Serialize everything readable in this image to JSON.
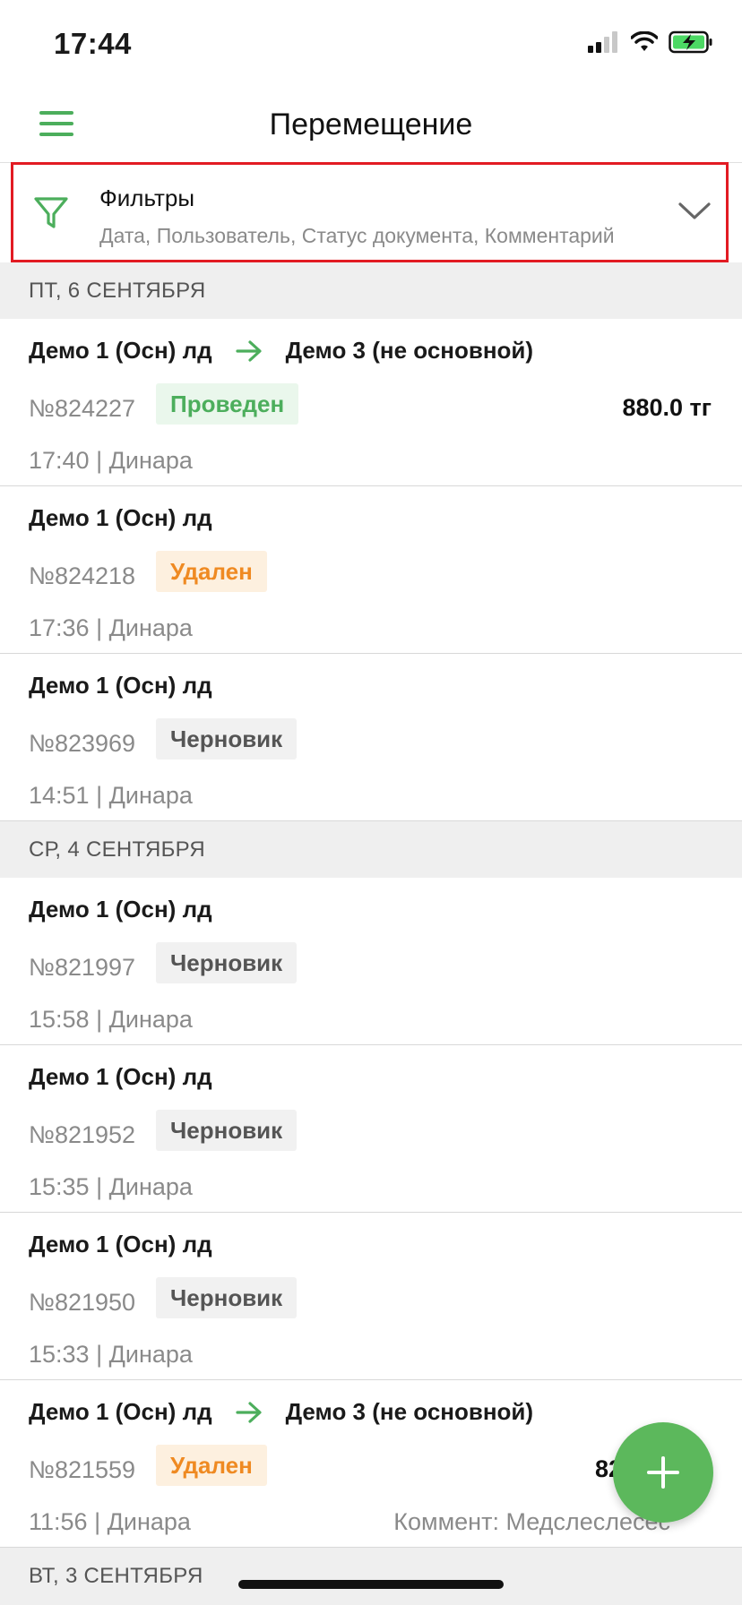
{
  "status_bar": {
    "time": "17:44"
  },
  "nav": {
    "title": "Перемещение"
  },
  "filters": {
    "title": "Фильтры",
    "subtitle": "Дата, Пользователь, Статус документа, Комментарий"
  },
  "sections": [
    {
      "date": "ПТ, 6 СЕНТЯБРЯ",
      "docs": [
        {
          "from": "Демо 1 (Осн) лд",
          "to": "Демо 3 (не основной)",
          "number": "№824227",
          "status": "Проведен",
          "amount": "880.0 тг",
          "meta": "17:40 | Динара"
        },
        {
          "from": "Демо 1 (Осн) лд",
          "number": "№824218",
          "status": "Удален",
          "meta": "17:36 | Динара"
        },
        {
          "from": "Демо 1 (Осн) лд",
          "number": "№823969",
          "status": "Черновик",
          "meta": "14:51 | Динара"
        }
      ]
    },
    {
      "date": "СР, 4 СЕНТЯБРЯ",
      "docs": [
        {
          "from": "Демо 1 (Осн) лд",
          "number": "№821997",
          "status": "Черновик",
          "meta": "15:58 | Динара"
        },
        {
          "from": "Демо 1 (Осн) лд",
          "number": "№821952",
          "status": "Черновик",
          "meta": "15:35 | Динара"
        },
        {
          "from": "Демо 1 (Осн) лд",
          "number": "№821950",
          "status": "Черновик",
          "meta": "15:33 | Динара"
        },
        {
          "from": "Демо 1 (Осн) лд",
          "to": "Демо 3 (не основной)",
          "number": "№821559",
          "status": "Удален",
          "amount": "82",
          "meta": "11:56 | Динара",
          "comment": "Коммент: Медслеслесес"
        }
      ]
    },
    {
      "date": "ВТ, 3 СЕНТЯБРЯ",
      "docs": []
    }
  ],
  "colors": {
    "accent": "#5cb85c",
    "highlight_border": "#e21b23",
    "status_done": "#4cae5c",
    "status_deleted": "#ef8a22",
    "status_draft": "#555555"
  },
  "icons": {
    "menu": "hamburger-icon",
    "filter": "funnel-icon",
    "chevron": "chevron-down-icon",
    "route": "arrow-right-icon",
    "fab": "plus-icon"
  }
}
